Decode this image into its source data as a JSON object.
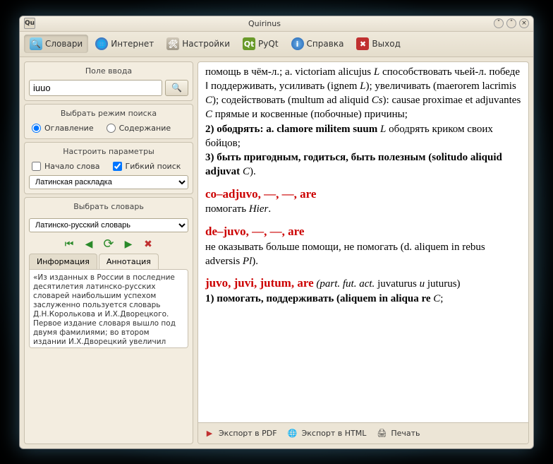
{
  "window": {
    "title": "Quirinus",
    "app_icon": "Qu"
  },
  "toolbar": {
    "dict": "Словари",
    "internet": "Интернет",
    "settings": "Настройки",
    "pyqt": "PyQt",
    "help": "Справка",
    "exit": "Выход"
  },
  "sidebar": {
    "input_title": "Поле ввода",
    "query": "iuuo",
    "mode_title": "Выбрать режим поиска",
    "mode_toc": "Оглавление",
    "mode_content": "Содержание",
    "params_title": "Настроить параметры",
    "param_start": "Начало слова",
    "param_flex": "Гибкий поиск",
    "layout_select": "Латинская раскладка",
    "dict_title": "Выбрать словарь",
    "dict_select": "Латинско-русский словарь",
    "tab_info": "Информация",
    "tab_anno": "Аннотация",
    "annotation": "«Из изданных в России в последние десятилетия латинско-русских словарей наибольшим успехом заслуженно пользуется словарь Д.Н.Королькова и И.Х.Дворецкого. Первое издание словаря вышло под двумя фамилиями; во втором издании И.Х.Дворецкий увеличил объем"
  },
  "article": {
    "l1": "помощь в чём-л.; a. victoriam alicujus ",
    "l1i": "L",
    "l2": " способствовать чьей-л. победе ‖ поддерживать, усиливать (ignem ",
    "l2i": "L",
    "l3": "); увеличивать (maerorem lacrimis ",
    "l3i": "C",
    "l4": "); содействовать (multum ad aliquid ",
    "l4i": "Cs",
    "l5": "): causae proximae et adjuvantes ",
    "l5i": "C",
    "l6": " прямые и косвенные (побочные) причины;",
    "p2a": "2) ободрять: a. clamore militem suum ",
    "p2i": "L",
    "p2b": " ободрять криком своих бойцов;",
    "p3a": "3) быть пригодным, годиться, быть полезным (solitudo aliquid adjuvat ",
    "p3i": "C",
    "p3b": ").",
    "hw1": "co–adjuvo, —, —, are",
    "hw1d": "помогать ",
    "hw1di": "Hier",
    "hw2": "de–juvo, —, —, are",
    "hw2d": "не оказывать больше помощи, не помогать (d. aliquem in rebus adversis ",
    "hw2di": "Pl",
    "hw2e": ").",
    "hw3": "juvo, juvi, jutum, are",
    "hw3p": " (part. fut. act. ",
    "hw3p2": "juvaturus ",
    "hw3p3": "u",
    "hw3p4": " juturus)",
    "hw3d": "1) помогать, поддерживать (aliquem in aliqua re ",
    "hw3di": "C",
    "hw3e": ";"
  },
  "bottom": {
    "pdf": "Экспорт в PDF",
    "html": "Экспорт в HTML",
    "print": "Печать"
  }
}
